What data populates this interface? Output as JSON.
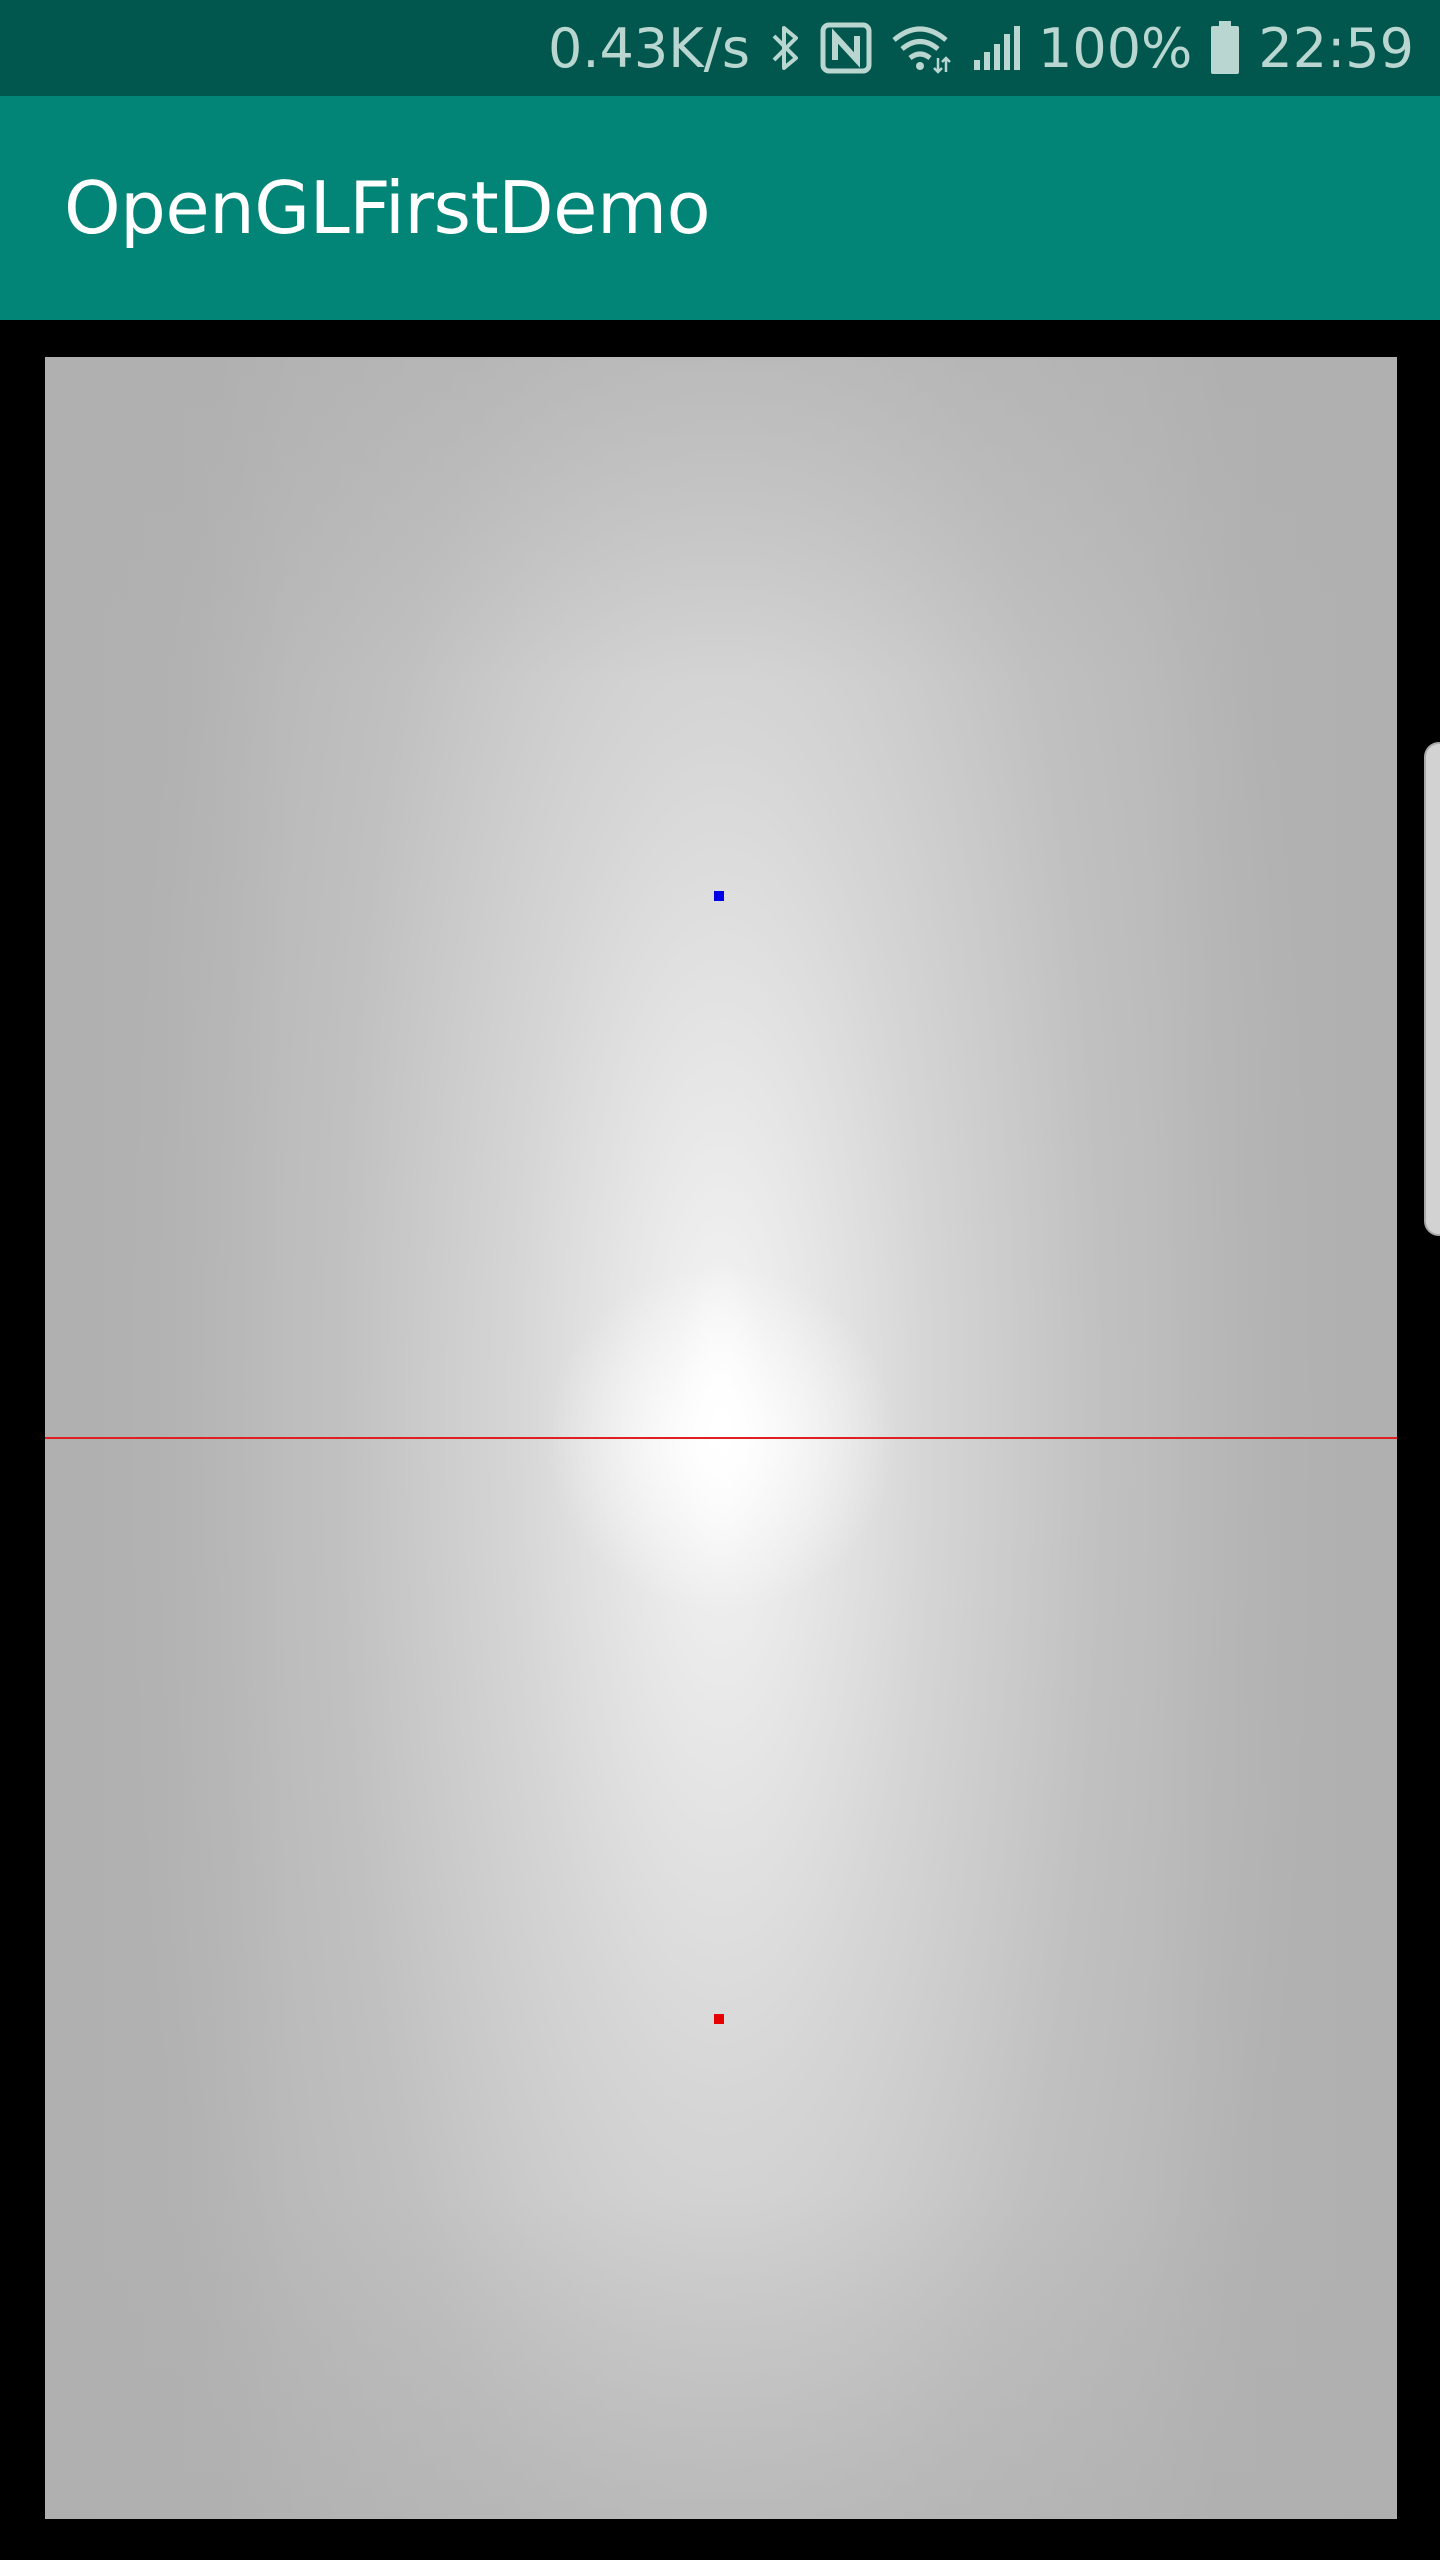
{
  "status_bar": {
    "network_speed": "0.43K/s",
    "battery": "100%",
    "time": "22:59",
    "icons": [
      "bluetooth-icon",
      "nfc-icon",
      "wifi-icon",
      "signal-icon",
      "battery-icon"
    ]
  },
  "app_bar": {
    "title": "OpenGLFirstDemo"
  },
  "gl_surface": {
    "background": "#b3b3b3",
    "center_highlight": "#ffffff",
    "line_color": "#e02020",
    "points": [
      {
        "name": "blue-point",
        "color": "#0000e6"
      },
      {
        "name": "red-point",
        "color": "#e60000"
      }
    ]
  },
  "colors": {
    "status_bar_bg": "#01574d",
    "app_bar_bg": "#028577",
    "content_bg": "#000000"
  }
}
